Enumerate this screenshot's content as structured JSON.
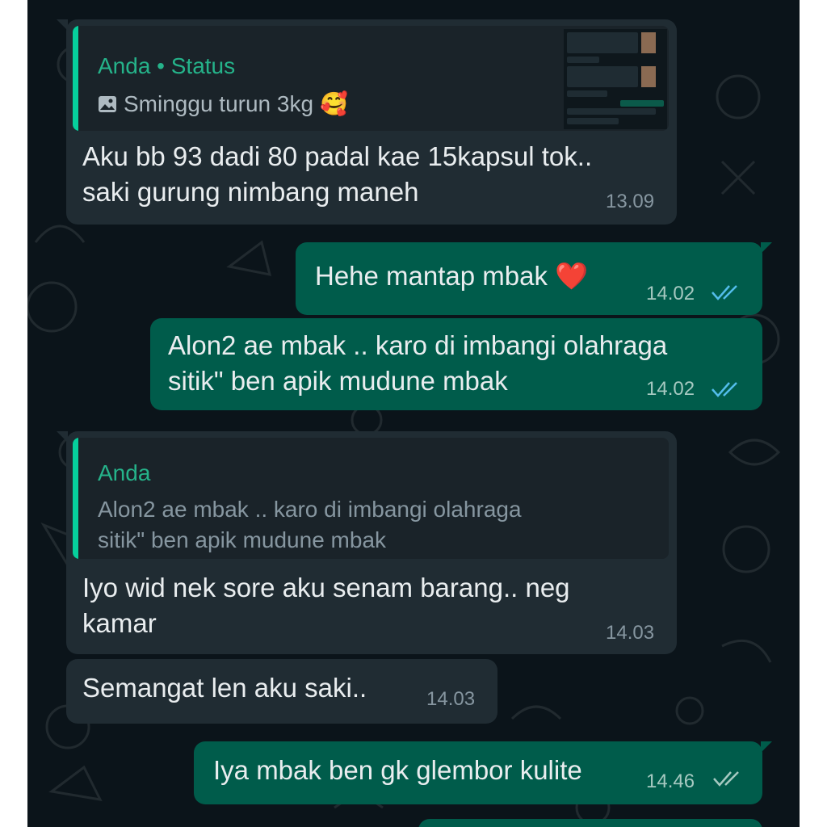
{
  "messages": [
    {
      "id": "m1",
      "direction": "incoming",
      "quote": {
        "author": "Anda • Status",
        "media_icon": "image-icon",
        "text": "Sminggu turun 3kg",
        "emoji": "🥰"
      },
      "text": "Aku bb 93 dadi 80 padal kae 15kapsul tok..\nsaki gurung nimbang maneh",
      "time": "13.09"
    },
    {
      "id": "m2",
      "direction": "outgoing",
      "text": "Hehe mantap mbak ❤️",
      "time": "14.02",
      "status": "read"
    },
    {
      "id": "m3",
      "direction": "outgoing",
      "text": "Alon2 ae mbak .. karo di imbangi olahraga\nsitik\" ben apik mudune mbak",
      "time": "14.02",
      "status": "read"
    },
    {
      "id": "m4",
      "direction": "incoming",
      "quote": {
        "author": "Anda",
        "text": "Alon2 ae mbak .. karo di imbangi olahraga\nsitik\" ben apik mudune mbak"
      },
      "text": "Iyo wid nek sore aku senam barang.. neg\nkamar",
      "time": "14.03"
    },
    {
      "id": "m5",
      "direction": "incoming",
      "text": "Semangat len aku saki..",
      "time": "14.03"
    },
    {
      "id": "m6",
      "direction": "outgoing",
      "text": "Iya mbak ben gk glembor kulite",
      "time": "14.46",
      "status": "delivered"
    }
  ],
  "colors": {
    "wallpaper": "#0b141a",
    "incoming_bubble": "#202c33",
    "outgoing_bubble": "#005c4b",
    "quote_accent": "#06cf9c",
    "read_ticks": "#53bdeb",
    "delivered_ticks": "#a6c9c1"
  }
}
